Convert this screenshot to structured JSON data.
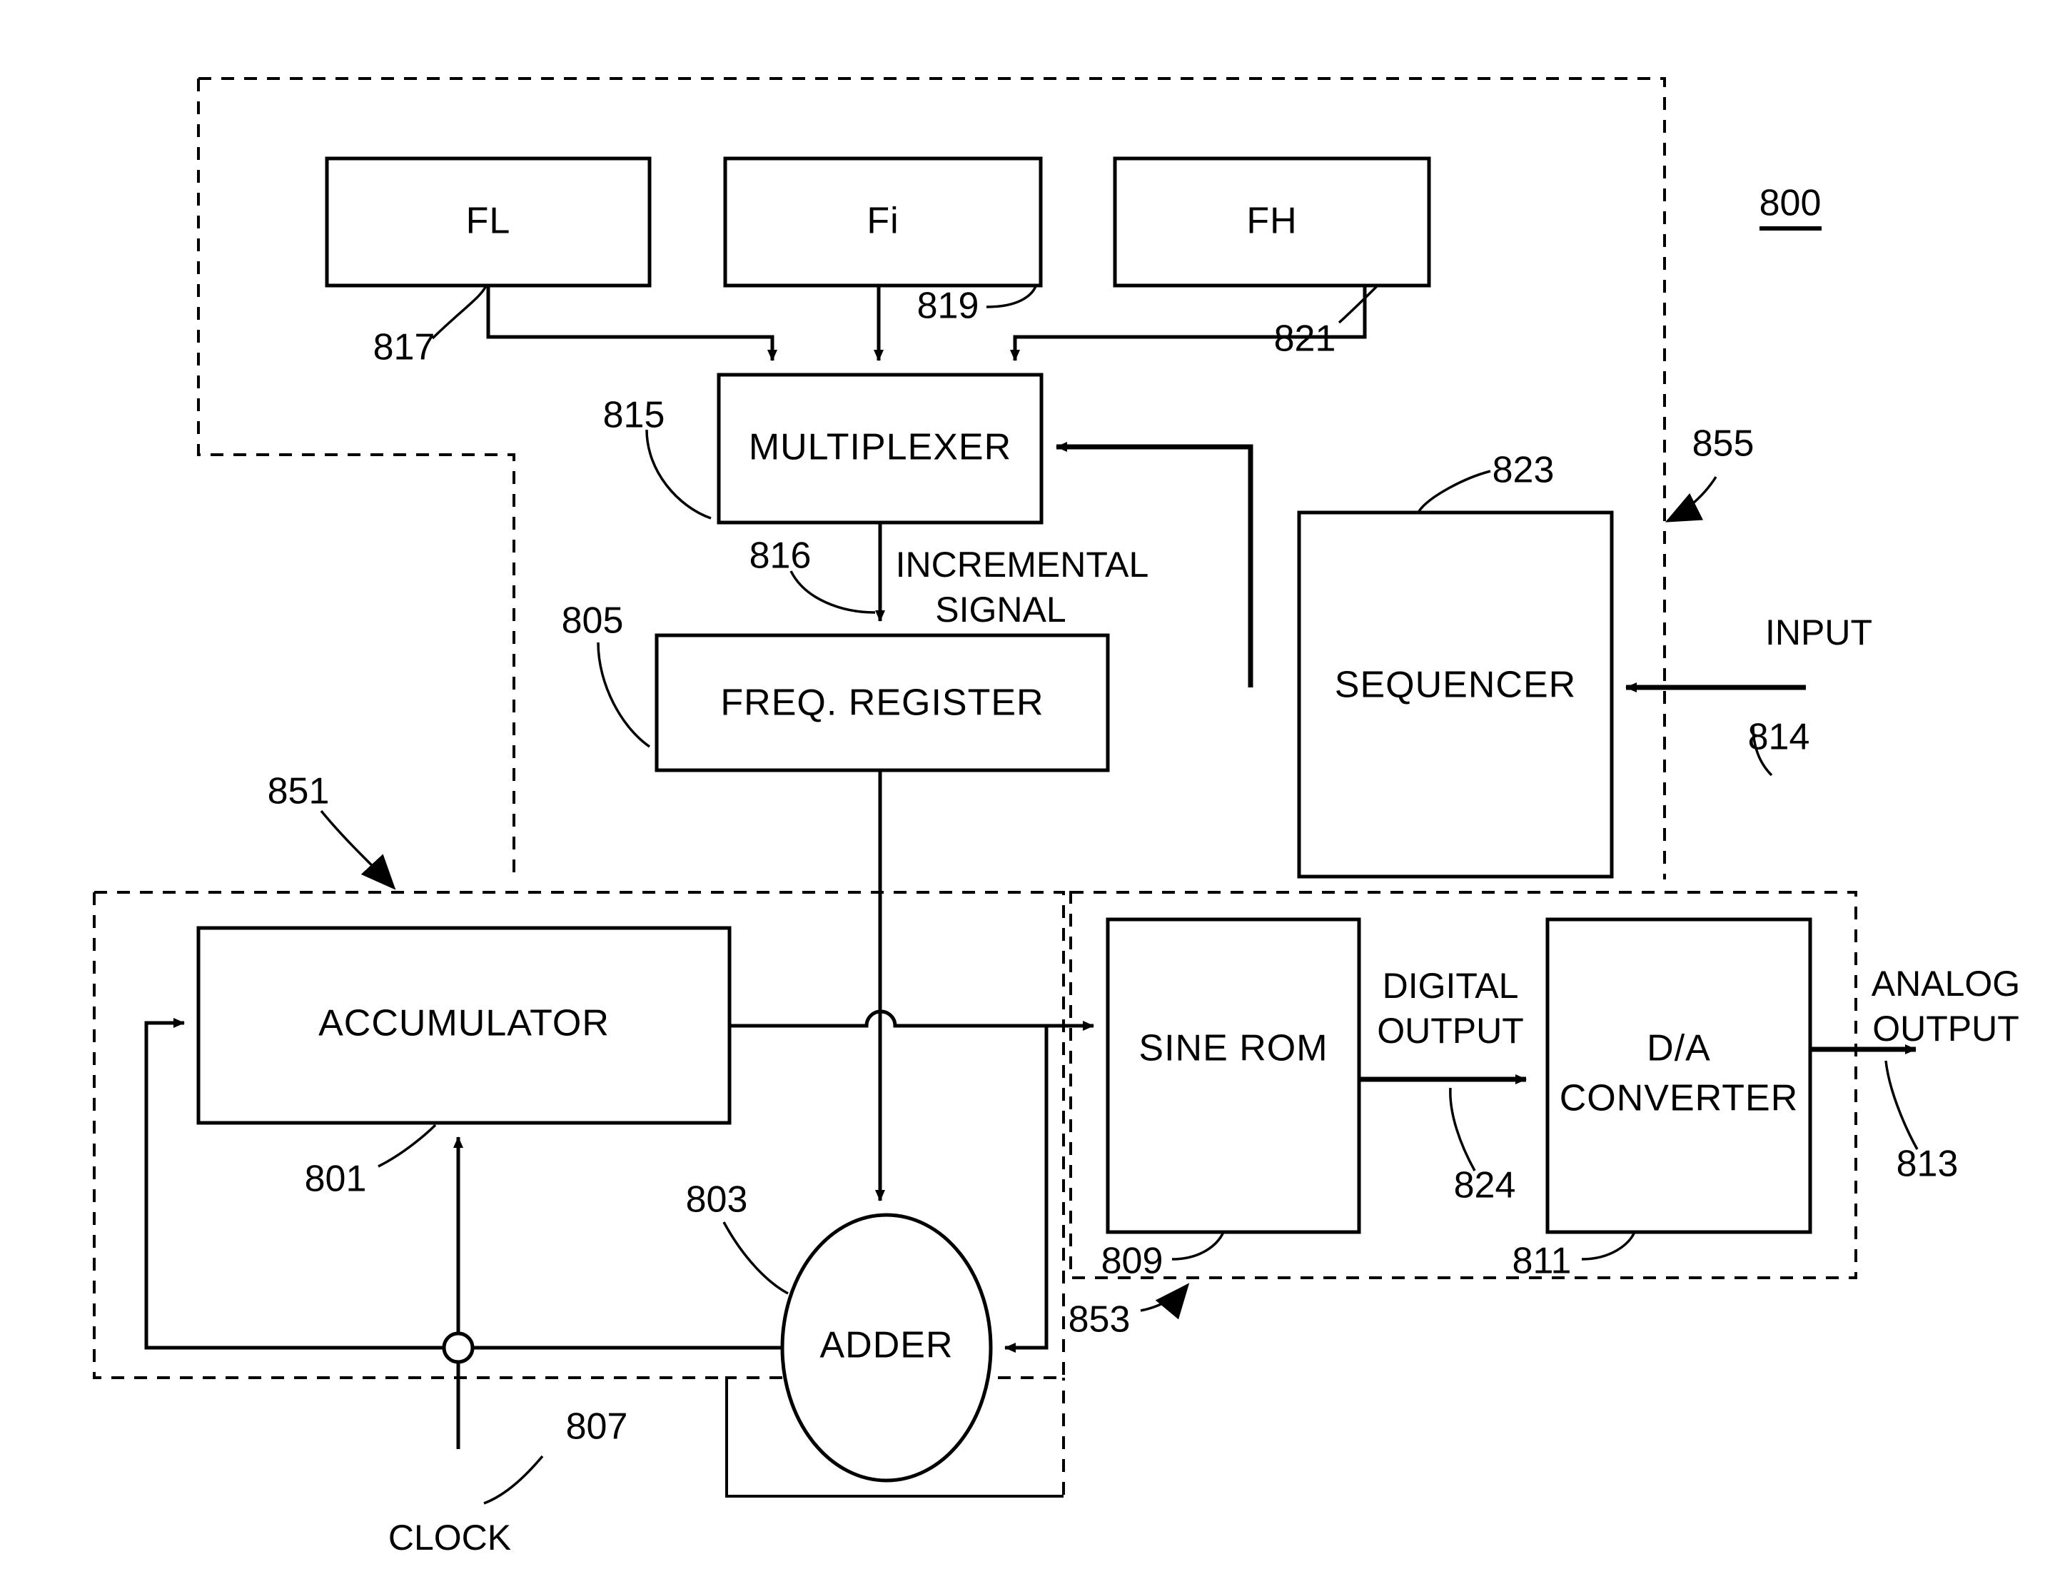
{
  "figure": {
    "number": "800",
    "type": "patent-block-diagram",
    "title_ref": "800"
  },
  "blocks": [
    {
      "id": "fl",
      "label": "FL",
      "ref": "817"
    },
    {
      "id": "fi",
      "label": "Fi",
      "ref": "819"
    },
    {
      "id": "fh",
      "label": "FH",
      "ref": "821"
    },
    {
      "id": "mux",
      "label": "MULTIPLEXER",
      "ref": "815"
    },
    {
      "id": "freqreg",
      "label": "FREQ. REGISTER",
      "ref": "805"
    },
    {
      "id": "sequencer",
      "label": "SEQUENCER",
      "ref": "823"
    },
    {
      "id": "accum",
      "label": "ACCUMULATOR",
      "ref": "801"
    },
    {
      "id": "adder",
      "label": "ADDER",
      "ref": "803"
    },
    {
      "id": "sinerom",
      "label": "SINE ROM",
      "ref": "809"
    },
    {
      "id": "dac",
      "label": "D/A CONVERTER",
      "ref": "811"
    }
  ],
  "dac_label_lines": {
    "line1": "D/A",
    "line2": "CONVERTER"
  },
  "signals": {
    "incremental": {
      "line1": "INCREMENTAL",
      "line2": "SIGNAL",
      "ref": "816"
    },
    "input": {
      "label": "INPUT",
      "ref": "814"
    },
    "clock": {
      "label": "CLOCK",
      "ref": "807"
    },
    "digital_output": {
      "line1": "DIGITAL",
      "line2": "OUTPUT",
      "ref": "824"
    },
    "analog_output": {
      "line1": "ANALOG",
      "line2": "OUTPUT",
      "ref": "813"
    }
  },
  "regions": [
    {
      "id": "outer",
      "ref": "855"
    },
    {
      "id": "phase",
      "ref": "851"
    },
    {
      "id": "output",
      "ref": "853"
    }
  ],
  "reference_numerals": {
    "r800": "800",
    "r801": "801",
    "r803": "803",
    "r805": "805",
    "r807": "807",
    "r809": "809",
    "r811": "811",
    "r813": "813",
    "r814": "814",
    "r815": "815",
    "r816": "816",
    "r817": "817",
    "r819": "819",
    "r821": "821",
    "r823": "823",
    "r824": "824",
    "r851": "851",
    "r853": "853",
    "r855": "855"
  },
  "colors": {
    "ink": "#000000",
    "paper": "#ffffff"
  }
}
